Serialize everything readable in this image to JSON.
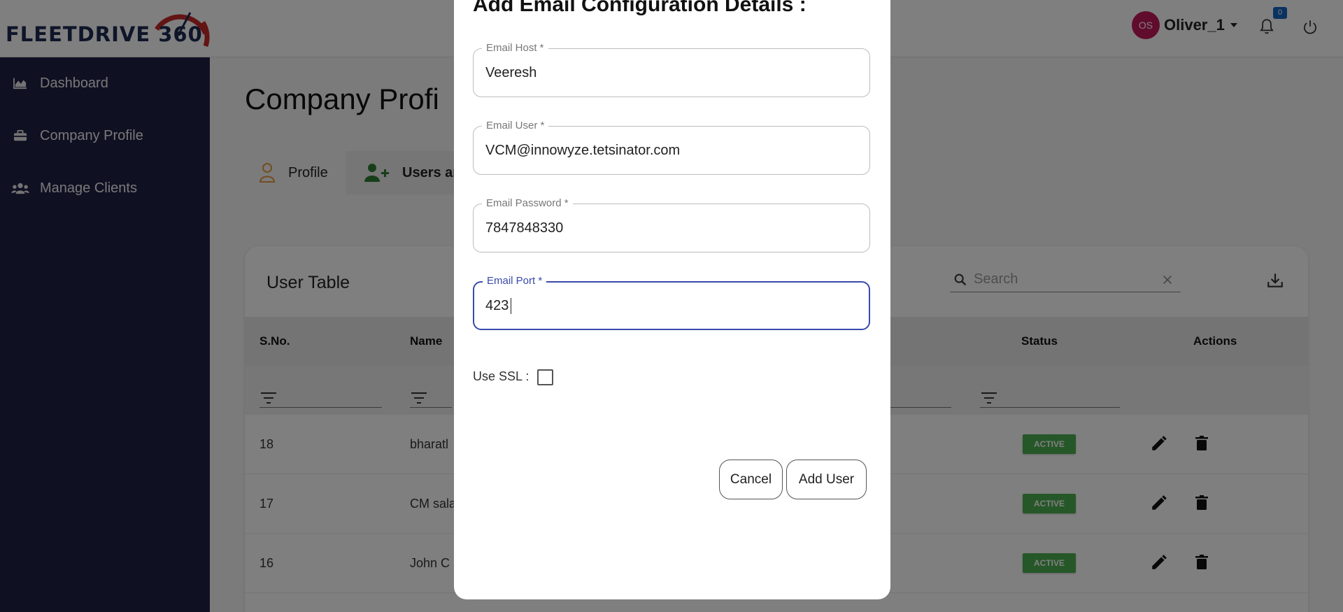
{
  "brand": {
    "logo_text": "FLEETDRIVE 360"
  },
  "header": {
    "avatar_initials": "OS",
    "user_name": "Oliver_1",
    "notification_count": "0"
  },
  "sidebar": {
    "items": [
      {
        "label": "Dashboard",
        "icon": "chart-area-icon"
      },
      {
        "label": "Company Profile",
        "icon": "briefcase-icon"
      },
      {
        "label": "Manage Clients",
        "icon": "users-icon"
      }
    ]
  },
  "page": {
    "title": "Company Profi",
    "tabs": [
      {
        "label": "Profile"
      },
      {
        "label": "Users ar"
      }
    ]
  },
  "user_table": {
    "title": "User Table",
    "search_placeholder": "Search",
    "columns": [
      "S.No.",
      "Name",
      "Status",
      "Actions"
    ],
    "rows": [
      {
        "sno": "18",
        "name": "bharatl",
        "status": "ACTIVE"
      },
      {
        "sno": "17",
        "name": "CM sala",
        "status": "ACTIVE"
      },
      {
        "sno": "16",
        "name": "John C",
        "status": "ACTIVE"
      }
    ]
  },
  "modal": {
    "title": "Add Email Configuration Details :",
    "fields": [
      {
        "label": "Email Host *",
        "value": "Veeresh"
      },
      {
        "label": "Email User *",
        "value": "VCM@innowyze.tetsinator.com"
      },
      {
        "label": "Email Password *",
        "value": "7847848330"
      },
      {
        "label": "Email Port *",
        "value": "423"
      }
    ],
    "ssl_label": "Use SSL :",
    "ssl_checked": false,
    "cancel_label": "Cancel",
    "submit_label": "Add User"
  },
  "colors": {
    "sidebar_bg": "#212146",
    "avatar_bg": "#c2185b",
    "focus_border": "#3949ab",
    "active_badge": "#4caf50",
    "logo_text": "#1e2a52",
    "logo_accent": "#c62828"
  }
}
